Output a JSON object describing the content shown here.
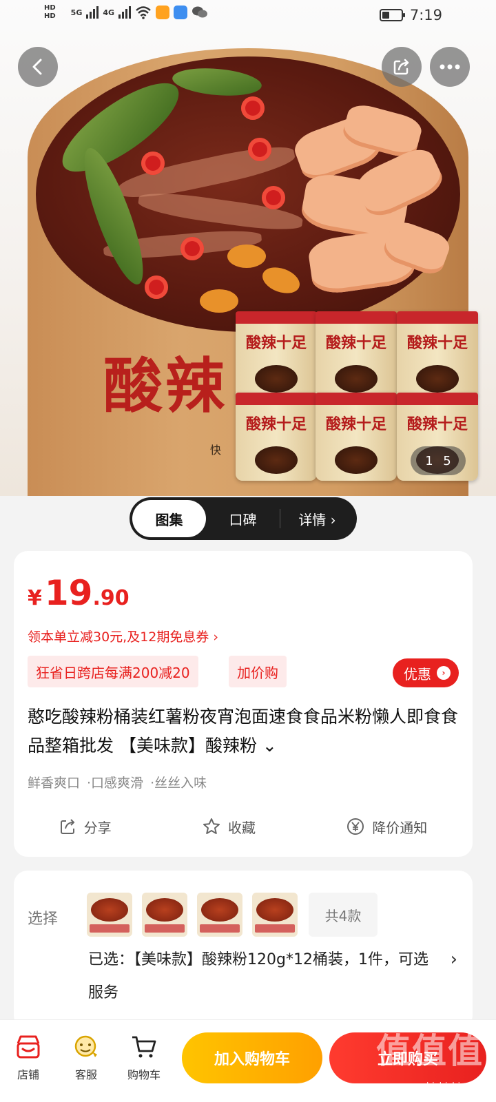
{
  "status_bar": {
    "hd1": "HD",
    "hd2": "HD",
    "net1": "5G",
    "net2": "4G",
    "time": "7:19"
  },
  "gallery": {
    "bowl_text": "酸辣",
    "bowl_sub": "快",
    "cup_label": "酸辣十足",
    "counter_current": "1",
    "counter_total": "5"
  },
  "tabs": [
    {
      "label": "图集",
      "active": true
    },
    {
      "label": "口碑",
      "active": false
    },
    {
      "label": "详情 ›",
      "active": false
    }
  ],
  "product": {
    "currency": "¥",
    "price_int": "19",
    "price_dec": ".90",
    "promo_line": "领本单立减30元,及12期免息券 ›",
    "tag1": "狂省日跨店每满200减20",
    "tag2": "加价购",
    "coupon_label": "优惠",
    "coupon_arrow": "›",
    "title": "憨吃酸辣粉桶装红薯粉夜宵泡面速食食品米粉懒人即食食品整箱批发 【美味款】酸辣粉 ⌄",
    "features": [
      "鲜香爽口",
      "·口感爽滑",
      "·丝丝入味"
    ],
    "actions": {
      "share": "分享",
      "favorite": "收藏",
      "price_alert": "降价通知"
    }
  },
  "selection": {
    "label": "选择",
    "count_chip": "共4款",
    "selected_text": "已选：【美味款】酸辣粉120g*12桶装，1件，可选服务",
    "chevron": "›"
  },
  "bottom_bar": {
    "store": "店铺",
    "service": "客服",
    "cart": "购物车",
    "add_to_cart": "加入购物车",
    "buy_now": "立即购买"
  },
  "watermark": {
    "text": "值值值",
    "url": "zhizhizhi.com"
  },
  "colors": {
    "accent_red": "#e8211f",
    "add_cart_yellow": "#ffb300",
    "dark_tab": "#1e1e1e"
  }
}
